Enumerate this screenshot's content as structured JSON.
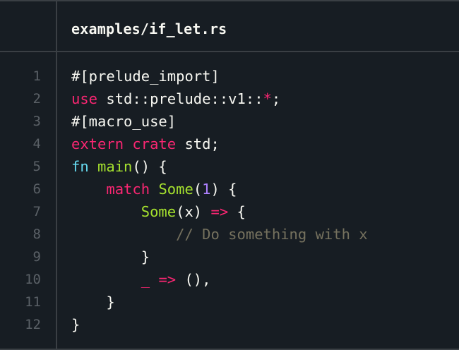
{
  "file": {
    "name": "examples/if_let.rs"
  },
  "colors": {
    "background": "#171d23",
    "border": "#3a3f44",
    "text": "#f8f8f2",
    "keyword": "#f92672",
    "function": "#66d9ef",
    "type": "#a6e22e",
    "number": "#ae81ff",
    "comment": "#75715e",
    "line_number": "#5a6066"
  },
  "lines": [
    {
      "num": "1",
      "tokens": [
        {
          "t": "#[prelude_import]",
          "c": "plain"
        }
      ]
    },
    {
      "num": "2",
      "tokens": [
        {
          "t": "use",
          "c": "kw"
        },
        {
          "t": " std::prelude::v1::",
          "c": "plain"
        },
        {
          "t": "*",
          "c": "op"
        },
        {
          "t": ";",
          "c": "plain"
        }
      ]
    },
    {
      "num": "3",
      "tokens": [
        {
          "t": "#[macro_use]",
          "c": "plain"
        }
      ]
    },
    {
      "num": "4",
      "tokens": [
        {
          "t": "extern",
          "c": "kw"
        },
        {
          "t": " ",
          "c": "plain"
        },
        {
          "t": "crate",
          "c": "kw"
        },
        {
          "t": " std;",
          "c": "plain"
        }
      ]
    },
    {
      "num": "5",
      "tokens": [
        {
          "t": "fn",
          "c": "fn"
        },
        {
          "t": " ",
          "c": "plain"
        },
        {
          "t": "main",
          "c": "ty"
        },
        {
          "t": "() {",
          "c": "plain"
        }
      ]
    },
    {
      "num": "6",
      "tokens": [
        {
          "t": "    ",
          "c": "plain"
        },
        {
          "t": "match",
          "c": "kw"
        },
        {
          "t": " ",
          "c": "plain"
        },
        {
          "t": "Some",
          "c": "ty"
        },
        {
          "t": "(",
          "c": "plain"
        },
        {
          "t": "1",
          "c": "num"
        },
        {
          "t": ") {",
          "c": "plain"
        }
      ]
    },
    {
      "num": "7",
      "tokens": [
        {
          "t": "        ",
          "c": "plain"
        },
        {
          "t": "Some",
          "c": "ty"
        },
        {
          "t": "(x) ",
          "c": "plain"
        },
        {
          "t": "=>",
          "c": "op"
        },
        {
          "t": " {",
          "c": "plain"
        }
      ]
    },
    {
      "num": "8",
      "tokens": [
        {
          "t": "            ",
          "c": "plain"
        },
        {
          "t": "// Do something with x",
          "c": "cm"
        }
      ]
    },
    {
      "num": "9",
      "tokens": [
        {
          "t": "        }",
          "c": "plain"
        }
      ]
    },
    {
      "num": "10",
      "tokens": [
        {
          "t": "        ",
          "c": "plain"
        },
        {
          "t": "_",
          "c": "op"
        },
        {
          "t": " ",
          "c": "plain"
        },
        {
          "t": "=>",
          "c": "op"
        },
        {
          "t": " (),",
          "c": "plain"
        }
      ]
    },
    {
      "num": "11",
      "tokens": [
        {
          "t": "    }",
          "c": "plain"
        }
      ]
    },
    {
      "num": "12",
      "tokens": [
        {
          "t": "}",
          "c": "plain"
        }
      ]
    }
  ]
}
